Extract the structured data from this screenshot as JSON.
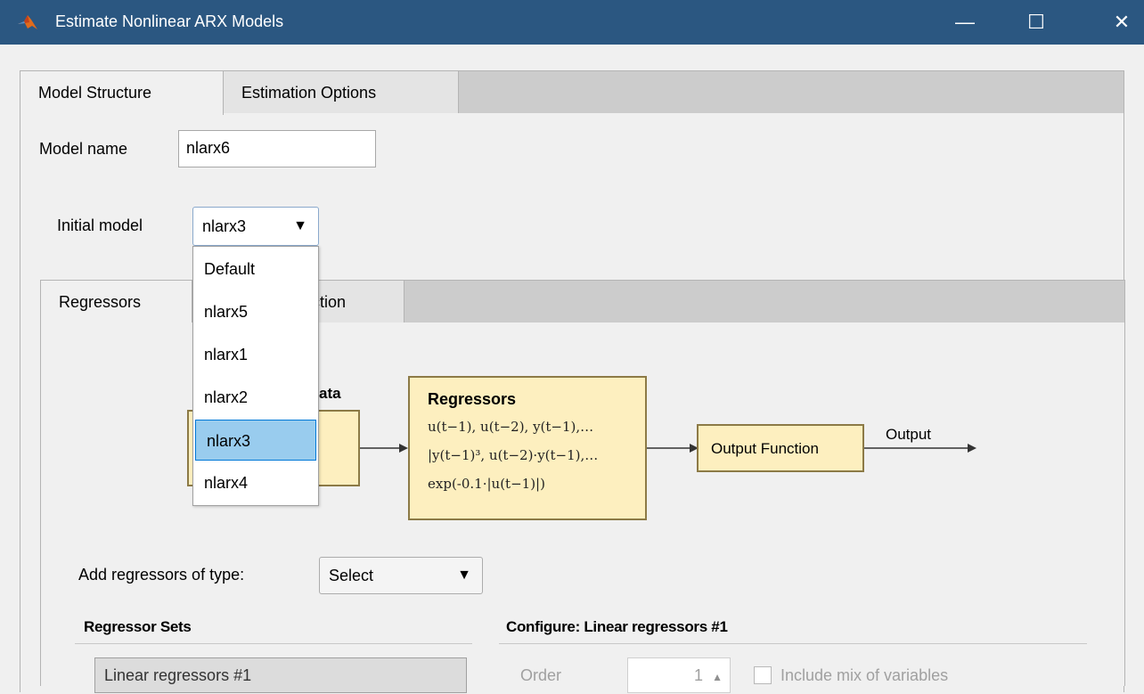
{
  "window": {
    "title": "Estimate Nonlinear ARX Models",
    "minimize": "—",
    "maximize": "☐",
    "close": "✕"
  },
  "tabs": {
    "model_structure": "Model Structure",
    "estimation_options": "Estimation Options"
  },
  "model_name": {
    "label": "Model name",
    "value": "nlarx6"
  },
  "initial_model": {
    "label": "Initial model",
    "selected": "nlarx3",
    "options": [
      "Default",
      "nlarx5",
      "nlarx1",
      "nlarx2",
      "nlarx3",
      "nlarx4"
    ]
  },
  "inner_tabs": {
    "regressors": "Regressors",
    "output_function_partial": "nction"
  },
  "diagram": {
    "data_label_partial": "ata",
    "input_lines_partial": [
      ")",
      ")"
    ],
    "regressors_title": "Regressors",
    "regressors_lines": [
      "u(t−1), u(t−2), y(t−1),…",
      "|y(t−1)³, u(t−2)·y(t−1),…",
      "exp(-0.1·|u(t−1)|)"
    ],
    "output_function": "Output Function",
    "output_label": "Output"
  },
  "add_regressors": {
    "label": "Add regressors of type:",
    "selected": "Select"
  },
  "regressor_sets": {
    "header": "Regressor Sets",
    "items": [
      "Linear regressors #1"
    ]
  },
  "configure": {
    "header": "Configure: Linear regressors #1",
    "order_label": "Order",
    "order_value": "1",
    "include_mix_label": "Include mix of variables"
  }
}
